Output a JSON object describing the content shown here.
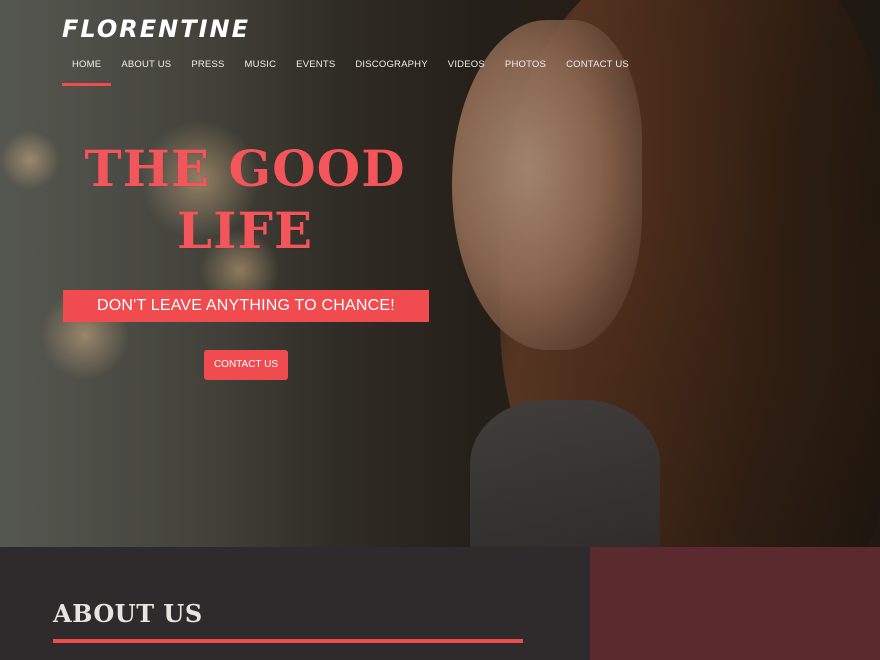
{
  "site": {
    "logo": "FLORENTINE"
  },
  "nav": {
    "items": [
      {
        "label": "HOME",
        "active": true
      },
      {
        "label": "ABOUT US",
        "active": false
      },
      {
        "label": "PRESS",
        "active": false
      },
      {
        "label": "MUSIC",
        "active": false
      },
      {
        "label": "EVENTS",
        "active": false
      },
      {
        "label": "DISCOGRAPHY",
        "active": false
      },
      {
        "label": "VIDEOS",
        "active": false
      },
      {
        "label": "PHOTOS",
        "active": false
      },
      {
        "label": "CONTACT US",
        "active": false
      }
    ]
  },
  "hero": {
    "headline_line1": "THE GOOD",
    "headline_line2": "LIFE",
    "tagline": "DON'T LEAVE ANYTHING TO CHANCE!",
    "cta_label": "CONTACT US"
  },
  "about": {
    "title": "ABOUT US"
  },
  "colors": {
    "accent": "#f04b4f",
    "dark_panel": "#2f2a2c",
    "maroon_panel": "#5b2a2f",
    "text_light": "#ffffff"
  }
}
